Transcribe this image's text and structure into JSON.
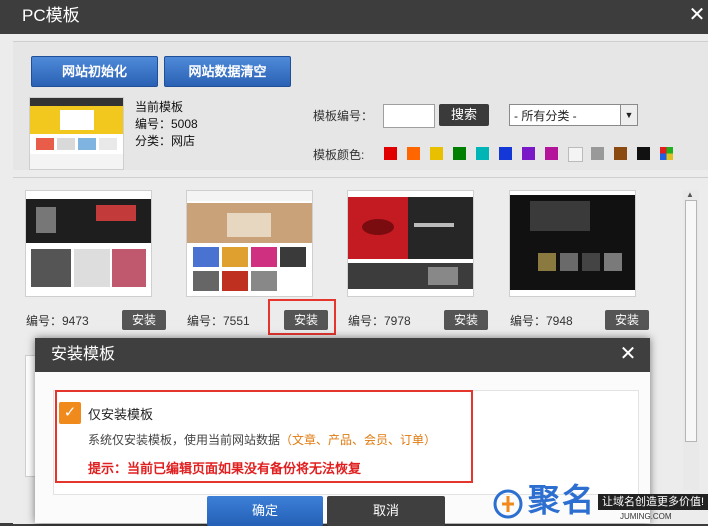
{
  "window": {
    "title": "PC模板",
    "close_glyph": "✕"
  },
  "toolbar": {
    "init_label": "网站初始化",
    "clear_label": "网站数据清空"
  },
  "current": {
    "heading": "当前模板",
    "code": "编号：5008",
    "category": "分类：网店"
  },
  "filter": {
    "code_label": "模板编号：",
    "code_value": "",
    "search_label": "搜索",
    "category_selected": "- 所有分类 -",
    "color_label": "模板颜色:",
    "colors": [
      "#e00000",
      "#ff6600",
      "#e8c000",
      "#008000",
      "#00b5b5",
      "#1438d8",
      "#7a18c8",
      "#b4149a",
      "#f4f4f4",
      "#999999",
      "#8b4a10",
      "#111111"
    ]
  },
  "templates": [
    {
      "code": "编号：9473",
      "install": "安装"
    },
    {
      "code": "编号：7551",
      "install": "安装"
    },
    {
      "code": "编号：7978",
      "install": "安装"
    },
    {
      "code": "编号：7948",
      "install": "安装"
    }
  ],
  "dialog": {
    "title": "安装模板",
    "close_glyph": "✕",
    "option_title": "仅安装模板",
    "option_desc_prefix": "系统仅安装模板，使用当前网站数据",
    "option_desc_highlight": "（文章、产品、会员、订单）",
    "warning": "提示：当前已编辑页面如果没有备份将无法恢复",
    "confirm_label": "确定",
    "cancel_label": "取消"
  },
  "watermark": {
    "brand": "聚名",
    "slogan": "让域名创造更多价值!",
    "url": "JUMING.COM"
  }
}
